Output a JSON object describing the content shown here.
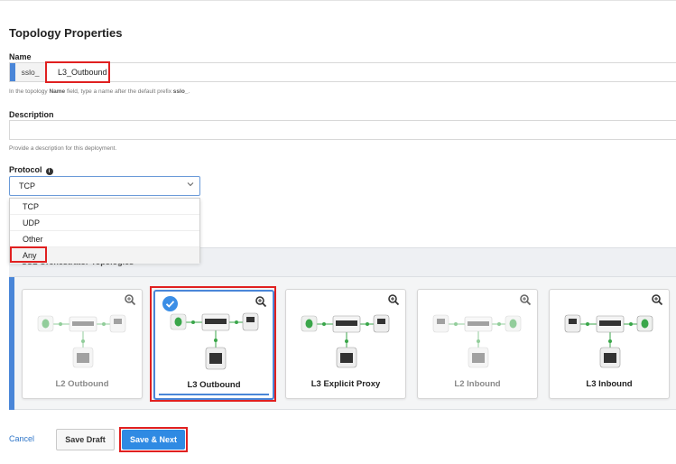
{
  "page": {
    "title": "Topology Properties"
  },
  "name_field": {
    "label": "Name",
    "prefix": "sslo_",
    "value": "L3_Outbound",
    "help_pre": "In the topology ",
    "help_bold": "Name",
    "help_mid": " field, type a name after the default prefix ",
    "help_bold2": "sslo_",
    "help_post": "."
  },
  "description_field": {
    "label": "Description",
    "value": "",
    "help": "Provide a description for this deployment."
  },
  "protocol_field": {
    "label": "Protocol",
    "info_icon": "info-circle-icon",
    "selected": "TCP",
    "options": [
      "TCP",
      "UDP",
      "Other",
      "Any"
    ]
  },
  "topologies": {
    "header": "SSL Orchestrator Topologies",
    "cards": [
      {
        "label": "L2 Outbound",
        "state": "disabled",
        "icon": "topology-diagram-icon"
      },
      {
        "label": "L3 Outbound",
        "state": "selected",
        "icon": "topology-diagram-icon"
      },
      {
        "label": "L3 Explicit Proxy",
        "state": "enabled",
        "icon": "topology-diagram-icon"
      },
      {
        "label": "L2 Inbound",
        "state": "disabled",
        "icon": "topology-diagram-icon"
      },
      {
        "label": "L3 Inbound",
        "state": "enabled",
        "icon": "topology-diagram-icon"
      }
    ]
  },
  "footer": {
    "cancel_label": "Cancel",
    "save_draft_label": "Save Draft",
    "save_next_label": "Save & Next"
  },
  "colors": {
    "accent": "#4a86d8",
    "primary_button": "#2f8ae3",
    "highlight": "#e02020",
    "green_node": "#3aa64a"
  }
}
